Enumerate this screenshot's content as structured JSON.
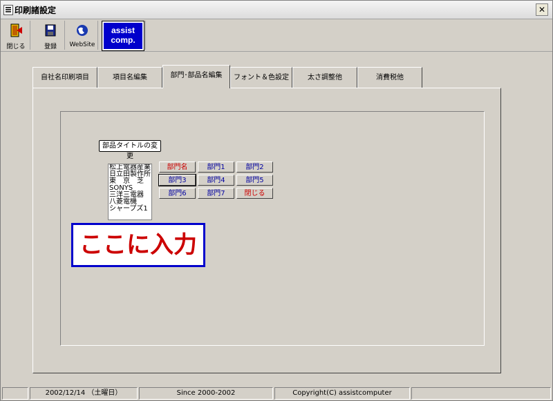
{
  "window": {
    "title": "印刷諸設定",
    "close_label": "✕"
  },
  "toolbar": {
    "close_label": "閉じる",
    "save_label": "登録",
    "website_label": "WebSite",
    "logo_line1": "assist",
    "logo_line2": "comp."
  },
  "tabs": [
    {
      "label": "自社名印刷項目"
    },
    {
      "label": "項目名編集"
    },
    {
      "label": "部門･部品名編集"
    },
    {
      "label": "フォント＆色設定"
    },
    {
      "label": "太さ調整他"
    },
    {
      "label": "消費税他"
    }
  ],
  "active_tab": 2,
  "panel": {
    "parts_title_button": "部品タイトルの変更",
    "list_items": [
      "松上電器産業",
      "日立田製作所",
      "東　京　芝",
      "SONYS",
      "三洋三電器",
      "八菱電機",
      "シャープズ1"
    ],
    "dept_buttons": [
      "部門名",
      "部門1",
      "部門2",
      "部門3",
      "部門4",
      "部門5",
      "部門6",
      "部門7",
      "閉じる"
    ],
    "input_text": "ここに入力"
  },
  "status": {
    "date": "2002/12/14 （土曜日）",
    "since": "Since 2000-2002",
    "copyright": "Copyright(C) assistcomputer"
  },
  "colors": {
    "logo_bg": "#0000cc",
    "input_border": "#0000cc",
    "input_text": "#cc0000",
    "dept_text": "#0000a0",
    "dept_text_red": "#cc0000"
  }
}
